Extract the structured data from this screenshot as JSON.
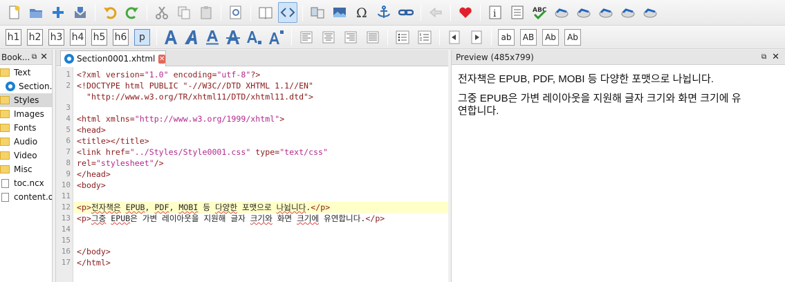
{
  "toolbar": {
    "heading_buttons": [
      "h1",
      "h2",
      "h3",
      "h4",
      "h5",
      "h6",
      "p"
    ],
    "style_buttons": [
      "ab",
      "AB",
      "Ab",
      "Ab"
    ]
  },
  "book_browser": {
    "title": "Book...",
    "items": [
      {
        "label": "Text",
        "kind": "folder"
      },
      {
        "label": "Section...",
        "kind": "file"
      },
      {
        "label": "Styles",
        "kind": "folder"
      },
      {
        "label": "Images",
        "kind": "folder"
      },
      {
        "label": "Fonts",
        "kind": "folder"
      },
      {
        "label": "Audio",
        "kind": "folder"
      },
      {
        "label": "Video",
        "kind": "folder"
      },
      {
        "label": "Misc",
        "kind": "folder"
      },
      {
        "label": "toc.ncx",
        "kind": "doc"
      },
      {
        "label": "content.op",
        "kind": "doc"
      }
    ]
  },
  "editor": {
    "tab_label": "Section0001.xhtml",
    "line_numbers": [
      "1",
      "2",
      "",
      "3",
      "4",
      "5",
      "6",
      "7",
      "8",
      "",
      "9",
      "10",
      "11",
      "12",
      "13",
      "14",
      "15",
      "16",
      "17"
    ]
  },
  "preview": {
    "title": "Preview (485x799)",
    "paragraph1": "전자책은 EPUB, PDF, MOBI 등 다양한 포맷으로 나뉩니다.",
    "paragraph2_line1": "그중 EPUB은 가변 레이아웃을 지원해 글자 크기와 화면 크기에 유",
    "paragraph2_line2": "연합니다."
  },
  "code_lines": {
    "l1_a": "<?xml ",
    "l1_b": "version=",
    "l1_c": "\"1.0\"",
    "l1_d": " encoding=",
    "l1_e": "\"utf-8\"",
    "l1_f": "?>",
    "l2": "<!DOCTYPE html PUBLIC \"-//W3C//DTD XHTML 1.1//EN\"",
    "l2b": "  \"http://www.w3.org/TR/xhtml11/DTD/xhtml11.dtd\">",
    "l5_a": "<html ",
    "l5_b": "xmlns=",
    "l5_c": "\"http://www.w3.org/1999/xhtml\"",
    "l5_d": ">",
    "l6": "<head>",
    "l7_a": "<title>",
    "l7_b": "</title>",
    "l8_a": "<link ",
    "l8_b": "href=",
    "l8_c": "\"../Styles/Style0001.css\"",
    "l8_d": " type=",
    "l8_e": "\"text/css\"",
    "l8b_a": "rel=",
    "l8b_b": "\"stylesheet\"",
    "l8b_c": "/>",
    "l9": "</head>",
    "l10": "<body>",
    "l12_open": "<p>",
    "l12_t1": "전자책은",
    "l12_t2": " ",
    "l12_t3": "EPUB",
    "l12_t4": ", ",
    "l12_t5": "PDF",
    "l12_t6": ", ",
    "l12_t7": "MOBI",
    "l12_t8": " 등 ",
    "l12_t9": "다양한",
    "l12_t10": " 포맷으로 ",
    "l12_t11": "나뉩니다",
    "l12_t12": ".",
    "l12_close": "</p>",
    "l13_open": "<p>",
    "l13_t1": "그중",
    "l13_t2": " ",
    "l13_t3": "EPUB",
    "l13_t4": "은 가변 레이아웃을 지원해 글자 ",
    "l13_t5": "크기와",
    "l13_t6": " 화면 ",
    "l13_t7": "크기에",
    "l13_t8": " 유연합니다.",
    "l13_close": "</p>",
    "l16": "</body>",
    "l17": "</html>"
  }
}
